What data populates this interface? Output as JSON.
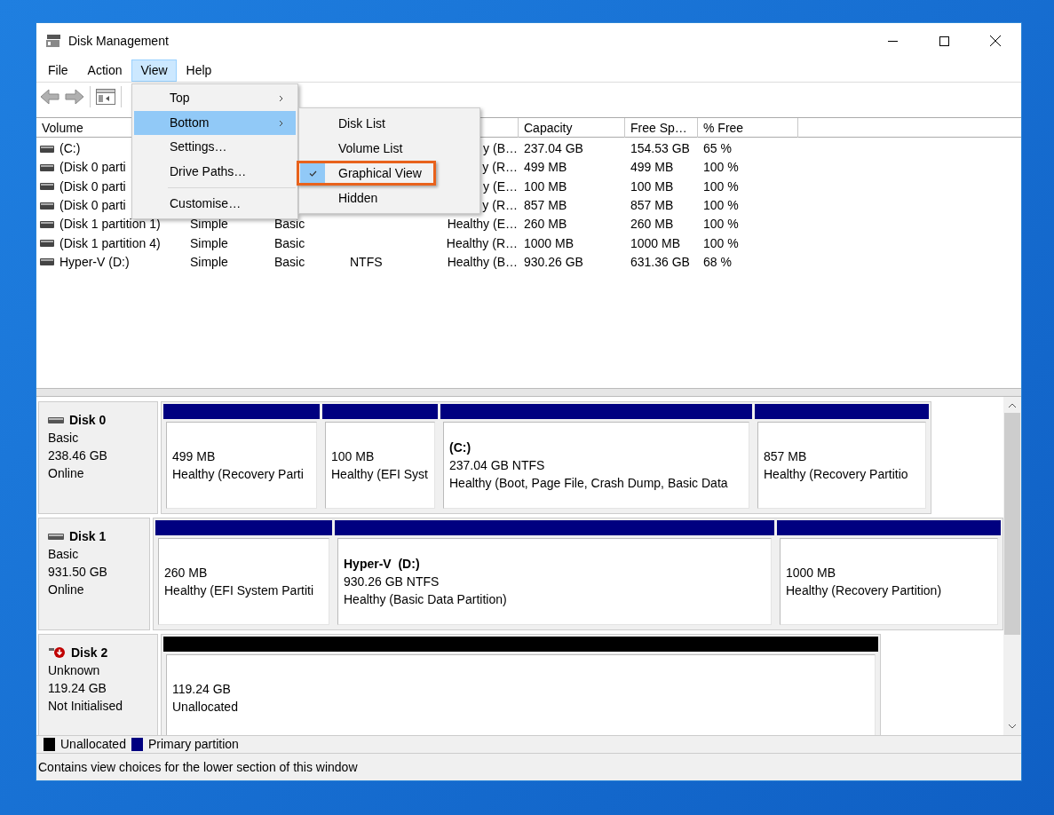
{
  "window": {
    "title": "Disk Management"
  },
  "menu_bar": [
    {
      "label": "File",
      "selected": false
    },
    {
      "label": "Action",
      "selected": false
    },
    {
      "label": "View",
      "selected": true
    },
    {
      "label": "Help",
      "selected": false
    }
  ],
  "view_menu": {
    "items": [
      {
        "kind": "item",
        "label": "Top",
        "submenu": true,
        "selected": false
      },
      {
        "kind": "item",
        "label": "Bottom",
        "submenu": true,
        "selected": true
      },
      {
        "kind": "item",
        "label": "Settings…",
        "submenu": false,
        "selected": false
      },
      {
        "kind": "item",
        "label": "Drive Paths…",
        "submenu": false,
        "selected": false
      },
      {
        "kind": "separator"
      },
      {
        "kind": "item",
        "label": "Customise…",
        "submenu": false,
        "selected": false
      }
    ]
  },
  "bottom_submenu": {
    "items": [
      {
        "label": "Disk List",
        "checked": false,
        "highlighted": false
      },
      {
        "label": "Volume List",
        "checked": false,
        "highlighted": false
      },
      {
        "label": "Graphical View",
        "checked": true,
        "highlighted": true
      },
      {
        "label": "Hidden",
        "checked": false,
        "highlighted": false
      }
    ]
  },
  "table": {
    "columns": [
      "Volume",
      null,
      null,
      null,
      null,
      "Capacity",
      "Free Sp…",
      "% Free"
    ],
    "rows": [
      {
        "cells": [
          "(C:)",
          null,
          null,
          null,
          "y (B…",
          "237.04 GB",
          "154.53 GB",
          "65 %"
        ]
      },
      {
        "cells": [
          "(Disk 0 parti",
          null,
          null,
          null,
          "y (R…",
          "499 MB",
          "499 MB",
          "100 %"
        ]
      },
      {
        "cells": [
          "(Disk 0 parti",
          null,
          null,
          null,
          "y (E…",
          "100 MB",
          "100 MB",
          "100 %"
        ]
      },
      {
        "cells": [
          "(Disk 0 parti",
          null,
          null,
          null,
          "y (R…",
          "857 MB",
          "857 MB",
          "100 %"
        ]
      },
      {
        "cells": [
          "(Disk 1 partition 1)",
          "Simple",
          "Basic",
          null,
          "Healthy (E…",
          "260 MB",
          "260 MB",
          "100 %"
        ]
      },
      {
        "cells": [
          "(Disk 1 partition 4)",
          "Simple",
          "Basic",
          null,
          "Healthy (R…",
          "1000 MB",
          "1000 MB",
          "100 %"
        ]
      },
      {
        "cells": [
          "Hyper-V (D:)",
          "Simple",
          "Basic",
          "NTFS",
          "Healthy (B…",
          "930.26 GB",
          "631.36 GB",
          "68 %"
        ]
      }
    ]
  },
  "disks": [
    {
      "name": "Disk 0",
      "type": "Basic",
      "size": "238.46 GB",
      "state": "Online",
      "error": false,
      "partitions": [
        {
          "size": "499 MB",
          "status": "Healthy (Recovery Parti",
          "color": "#000080"
        },
        {
          "size": "100 MB",
          "status": "Healthy (EFI Syst",
          "color": "#000080"
        },
        {
          "title": "(C:)",
          "size": "237.04 GB NTFS",
          "status": "Healthy (Boot, Page File, Crash Dump, Basic Data",
          "color": "#000080"
        },
        {
          "size": "857 MB",
          "status": "Healthy (Recovery Partitio",
          "color": "#000080"
        }
      ]
    },
    {
      "name": "Disk 1",
      "type": "Basic",
      "size": "931.50 GB",
      "state": "Online",
      "error": false,
      "partitions": [
        {
          "size": "260 MB",
          "status": "Healthy (EFI System Partiti",
          "color": "#000080"
        },
        {
          "title": "Hyper-V  (D:)",
          "size": "930.26 GB NTFS",
          "status": "Healthy (Basic Data Partition)",
          "color": "#000080"
        },
        {
          "size": "1000 MB",
          "status": "Healthy (Recovery Partition)",
          "color": "#000080"
        }
      ]
    },
    {
      "name": "Disk 2",
      "type": "Unknown",
      "size": "119.24 GB",
      "state": "Not Initialised",
      "error": true,
      "partitions": [
        {
          "size": "119.24 GB",
          "status": "Unallocated",
          "color": "#000000"
        }
      ]
    }
  ],
  "legend": [
    {
      "label": "Unallocated",
      "color": "#000000"
    },
    {
      "label": "Primary partition",
      "color": "#000080"
    }
  ],
  "status_bar": "Contains view choices for the lower section of this window"
}
